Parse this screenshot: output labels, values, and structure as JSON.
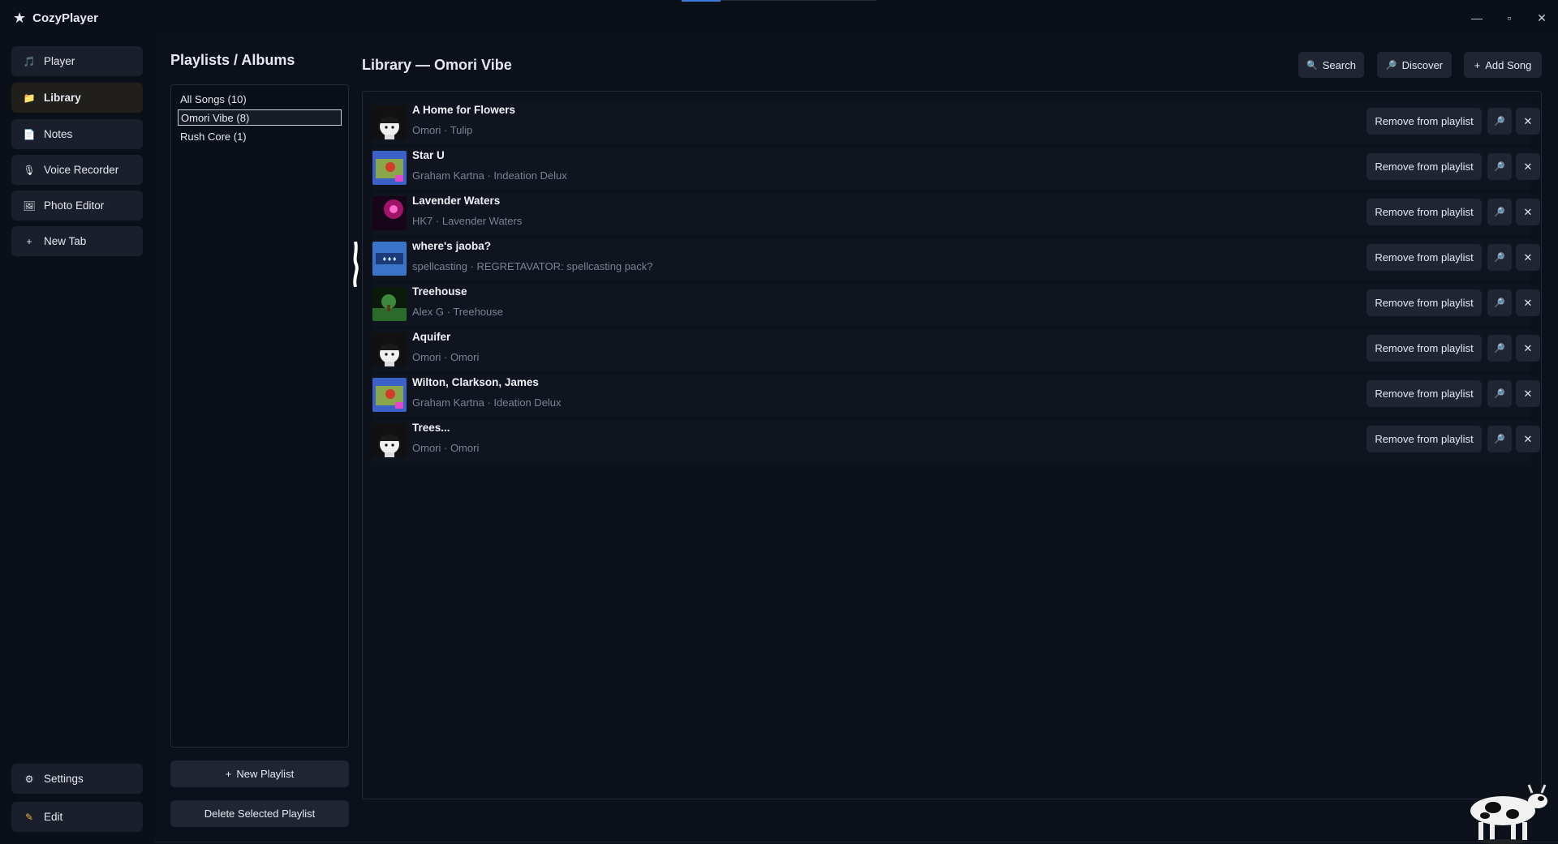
{
  "app": {
    "title": "CozyPlayer"
  },
  "window_controls": {
    "minimize": "—",
    "restore": "▫",
    "close": "✕"
  },
  "sidebar": {
    "items": [
      {
        "label": "Player",
        "icon": "music-note-icon",
        "glyph": "🎵",
        "active": false
      },
      {
        "label": "Library",
        "icon": "folder-icon",
        "glyph": "📁",
        "active": true
      },
      {
        "label": "Notes",
        "icon": "notepad-icon",
        "glyph": "📄",
        "active": false
      },
      {
        "label": "Voice Recorder",
        "icon": "microphone-icon",
        "glyph": "🎙",
        "active": false
      },
      {
        "label": "Photo Editor",
        "icon": "image-icon",
        "glyph": "🖼",
        "active": false
      },
      {
        "label": "New Tab",
        "icon": "plus-icon",
        "glyph": "+",
        "active": false
      }
    ],
    "bottom": [
      {
        "label": "Settings",
        "icon": "gear-icon",
        "glyph": "⚙"
      },
      {
        "label": "Edit",
        "icon": "pencil-icon",
        "glyph": "✎"
      }
    ]
  },
  "playlists": {
    "title": "Playlists / Albums",
    "items": [
      {
        "label": "All Songs  (10)",
        "selected": false
      },
      {
        "label": "Omori Vibe  (8)",
        "selected": true
      },
      {
        "label": "Rush Core  (1)",
        "selected": false
      }
    ],
    "new_playlist": "New Playlist",
    "new_playlist_glyph": "+",
    "delete_playlist": "Delete Selected Playlist"
  },
  "library": {
    "title": "Library — Omori Vibe",
    "search_label": "Search",
    "search_glyph": "🔍",
    "discover_label": "Discover",
    "discover_glyph": "🔎",
    "add_song_label": "Add Song",
    "add_song_glyph": "+",
    "remove_label": "Remove from playlist",
    "find_glyph": "🔎",
    "delete_glyph": "✕",
    "songs": [
      {
        "title": "A Home for Flowers",
        "subtitle": "Omori · Tulip",
        "cover": "omori"
      },
      {
        "title": "Star U",
        "subtitle": "Graham Kartna · Indeation Delux",
        "cover": "ideation"
      },
      {
        "title": "Lavender Waters",
        "subtitle": "HK7 · Lavender Waters",
        "cover": "lavender"
      },
      {
        "title": "where's jaoba?",
        "subtitle": "spellcasting · REGRETAVATOR: spellcasting pack?",
        "cover": "spell"
      },
      {
        "title": "Treehouse",
        "subtitle": "Alex G · Treehouse",
        "cover": "treehouse"
      },
      {
        "title": "Aquifer",
        "subtitle": "Omori · Omori",
        "cover": "omori"
      },
      {
        "title": "Wilton, Clarkson, James",
        "subtitle": "Graham Kartna · Ideation Delux",
        "cover": "ideation"
      },
      {
        "title": "Trees...",
        "subtitle": "Omori · Omori",
        "cover": "omori"
      }
    ]
  }
}
